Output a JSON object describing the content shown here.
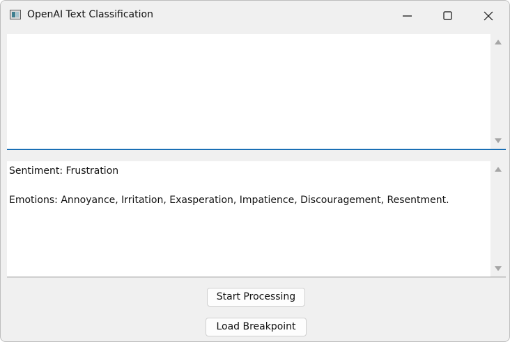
{
  "window": {
    "title": "OpenAI Text Classification",
    "icon": "app-window-icon",
    "controls": [
      "minimize-icon",
      "maximize-icon",
      "close-icon"
    ]
  },
  "input": {
    "value": ""
  },
  "output": {
    "line1": "Sentiment: Frustration",
    "line2": "Emotions: Annoyance, Irritation, Exasperation, Impatience, Discouragement, Resentment."
  },
  "buttons": {
    "start_label": "Start Processing",
    "load_label": "Load Breakpoint"
  },
  "colors": {
    "focus_accent": "#1a6fb5"
  }
}
